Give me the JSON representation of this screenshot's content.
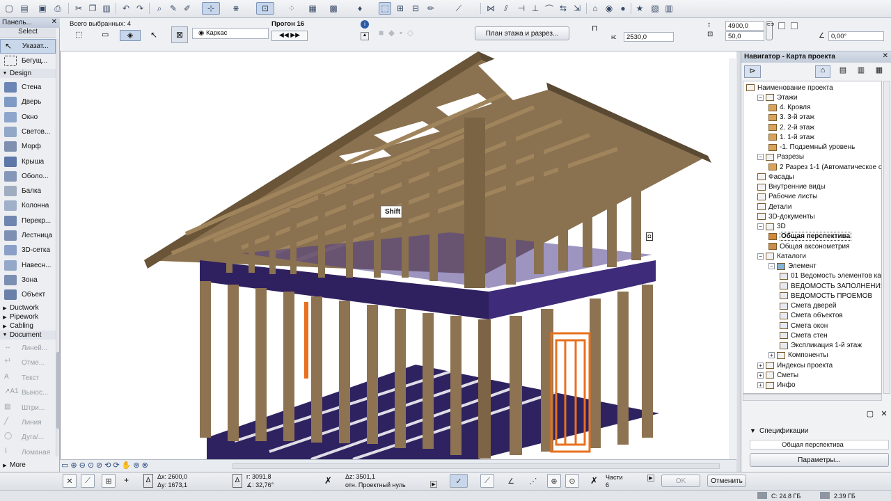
{
  "toolbox": {
    "title": "Панель...",
    "select_label": "Select",
    "pointer": "Указат...",
    "marquee": "Бегущ...",
    "design_group": "Design",
    "design_tools": [
      "Стена",
      "Дверь",
      "Окно",
      "Светов...",
      "Морф",
      "Крыша",
      "Оболо...",
      "Балка",
      "Колонна",
      "Перекр...",
      "Лестница",
      "3D-сетка",
      "Навесн...",
      "Зона",
      "Объект"
    ],
    "groups": [
      "Ductwork",
      "Pipework",
      "Cabling",
      "Document"
    ],
    "document_tools": [
      "Линей...",
      "Отме...",
      "Текст",
      "Вынос...",
      "Штри...",
      "Линия",
      "Дуга/...",
      "Ломаная"
    ],
    "more_label": "More"
  },
  "infobox": {
    "selected_label": "Всего выбранных: 4",
    "mode": "Каркас",
    "run_label": "Прогон 16",
    "plan_button": "План этажа и разрез...",
    "elevation_label": "н:",
    "elevation_value": "2530,0",
    "height_value": "4900,0",
    "width_value": "50,0",
    "angle_value": "0,00°"
  },
  "viewport": {
    "tooltip": "Shift"
  },
  "navigator": {
    "title": "Навигатор - Карта проекта",
    "tree": [
      {
        "label": "Наименование проекта",
        "level": 0,
        "exp": "",
        "icon": "house-icon"
      },
      {
        "label": "Этажи",
        "level": 1,
        "exp": "−",
        "icon": "stories-icon"
      },
      {
        "label": "4. Кровля",
        "level": 2,
        "exp": "",
        "icon": "story-icon"
      },
      {
        "label": "3. 3-й этаж",
        "level": 2,
        "exp": "",
        "icon": "story-icon"
      },
      {
        "label": "2. 2-й этаж",
        "level": 2,
        "exp": "",
        "icon": "story-icon"
      },
      {
        "label": "1. 1-й этаж",
        "level": 2,
        "exp": "",
        "icon": "story-icon"
      },
      {
        "label": "-1. Подземный уровень",
        "level": 2,
        "exp": "",
        "icon": "story-icon"
      },
      {
        "label": "Разрезы",
        "level": 1,
        "exp": "−",
        "icon": "section-icon"
      },
      {
        "label": "2 Разрез 1-1 (Автоматическое о",
        "level": 2,
        "exp": "",
        "icon": "section-item-icon"
      },
      {
        "label": "Фасады",
        "level": 1,
        "exp": "",
        "icon": "elevation-icon"
      },
      {
        "label": "Внутренние виды",
        "level": 1,
        "exp": "",
        "icon": "interior-icon"
      },
      {
        "label": "Рабочие листы",
        "level": 1,
        "exp": "",
        "icon": "worksheet-icon"
      },
      {
        "label": "Детали",
        "level": 1,
        "exp": "",
        "icon": "detail-icon"
      },
      {
        "label": "3D-документы",
        "level": 1,
        "exp": "",
        "icon": "doc3d-icon"
      },
      {
        "label": "3D",
        "level": 1,
        "exp": "−",
        "icon": "3d-icon"
      },
      {
        "label": "Общая перспектива",
        "level": 2,
        "exp": "",
        "icon": "perspective-icon",
        "selected": true
      },
      {
        "label": "Общая аксонометрия",
        "level": 2,
        "exp": "",
        "icon": "axonometry-icon"
      },
      {
        "label": "Каталоги",
        "level": 1,
        "exp": "−",
        "icon": "catalog-icon"
      },
      {
        "label": "Элемент",
        "level": 2,
        "exp": "−",
        "icon": "element-icon"
      },
      {
        "label": "01 Ведомость элементов кар",
        "level": 3,
        "exp": "",
        "icon": "list-icon"
      },
      {
        "label": "ВЕДОМОСТЬ ЗАПОЛНЕНИЯ С",
        "level": 3,
        "exp": "",
        "icon": "list-icon"
      },
      {
        "label": "ВЕДОМОСТЬ ПРОЕМОВ",
        "level": 3,
        "exp": "",
        "icon": "list-icon"
      },
      {
        "label": "Смета дверей",
        "level": 3,
        "exp": "",
        "icon": "list-icon"
      },
      {
        "label": "Смета объектов",
        "level": 3,
        "exp": "",
        "icon": "list-icon"
      },
      {
        "label": "Смета окон",
        "level": 3,
        "exp": "",
        "icon": "list-icon"
      },
      {
        "label": "Смета стен",
        "level": 3,
        "exp": "",
        "icon": "list-icon"
      },
      {
        "label": "Экспликация 1-й этаж",
        "level": 3,
        "exp": "",
        "icon": "list-icon"
      },
      {
        "label": "Компоненты",
        "level": 2,
        "exp": "+",
        "icon": "component-icon"
      },
      {
        "label": "Индексы проекта",
        "level": 1,
        "exp": "+",
        "icon": "index-icon"
      },
      {
        "label": "Сметы",
        "level": 1,
        "exp": "+",
        "icon": "estimate-icon"
      },
      {
        "label": "Инфо",
        "level": 1,
        "exp": "+",
        "icon": "info-icon"
      }
    ],
    "spec_label": "Спецификации",
    "spec_value": "Общая перспектива",
    "params_button": "Параметры..."
  },
  "bottombar": {
    "dx": "Δx: 2600,0",
    "dy": "Δy: 1673,1",
    "r": "r: 3091,8",
    "angle": "∡: 32,76°",
    "dz": "Δz: 3501,1",
    "ref": "отн. Проектный нуль",
    "parts_label": "Части",
    "parts_value": "6",
    "ok": "OK",
    "cancel": "Отменить"
  },
  "status": {
    "disk_c": "C: 24.8 ГБ",
    "memory": "2.39 ГБ"
  },
  "colors": {
    "wood": "#7b6446",
    "wood_light": "#a88b63",
    "beam_purple": "#3a2a6e",
    "selection_orange": "#e8701e",
    "accent": "#c9d7ea"
  }
}
